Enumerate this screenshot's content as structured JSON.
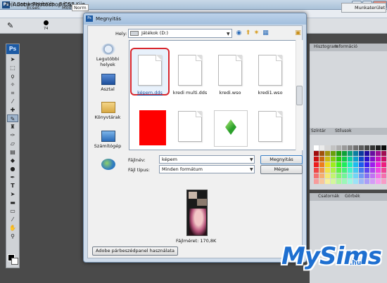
{
  "app": {
    "title": "Adobe Photoshop CS3",
    "logo": "Ps",
    "menu": [
      "Fájl",
      "Szerkesztés",
      "Kép",
      "Réteg",
      "Kije"
    ],
    "options": {
      "size_label": "Ecset:",
      "size_value": "74",
      "mode_label": "Mód:",
      "mode_value": "Norm"
    },
    "workspace_label": "Munkaterület"
  },
  "right_panels": {
    "top_tabs": [
      "Hisztogram",
      "Információ"
    ],
    "mid_tabs": [
      "Színtár",
      "Stílusok"
    ],
    "bottom_tabs": [
      "Csatornák",
      "Görbék"
    ]
  },
  "dialog": {
    "title": "Megnyitás",
    "location_label": "Hely:",
    "location_value": "Játékok (D:)",
    "places": [
      {
        "label": "Legutóbbi helyek",
        "icon": "recent-places-icon"
      },
      {
        "label": "Asztal",
        "icon": "desktop-icon"
      },
      {
        "label": "Könyvtárak",
        "icon": "libraries-icon"
      },
      {
        "label": "Számítógép",
        "icon": "computer-icon"
      },
      {
        "label": "",
        "icon": "network-icon"
      }
    ],
    "files": [
      {
        "name": "képem.dds",
        "type": "doc",
        "selected": true
      },
      {
        "name": "kredi multi.dds",
        "type": "doc",
        "selected": false
      },
      {
        "name": "kredi.wso",
        "type": "doc",
        "selected": false
      },
      {
        "name": "kredi1.wso",
        "type": "doc",
        "selected": false
      },
      {
        "name": "",
        "type": "red",
        "selected": false
      },
      {
        "name": "",
        "type": "doc",
        "selected": false
      },
      {
        "name": "",
        "type": "sims",
        "selected": false
      },
      {
        "name": "",
        "type": "doc",
        "selected": false
      }
    ],
    "filename_label": "Fájlnév:",
    "filename_value": "képem",
    "filetype_label": "Fájl típus:",
    "filetype_value": "Minden formátum",
    "open_button": "Megnyitás",
    "cancel_button": "Mégse",
    "filesize_text": "Fájlméret: 170,8K",
    "adobe_dialog_button": "Adobe párbeszédpanel használata"
  },
  "watermark": {
    "text": "MySims",
    "suffix": ".hu"
  },
  "colors": {
    "accent": "#1e6fd0",
    "selection": "#d9262c",
    "red_thumb": "#ff0000"
  }
}
